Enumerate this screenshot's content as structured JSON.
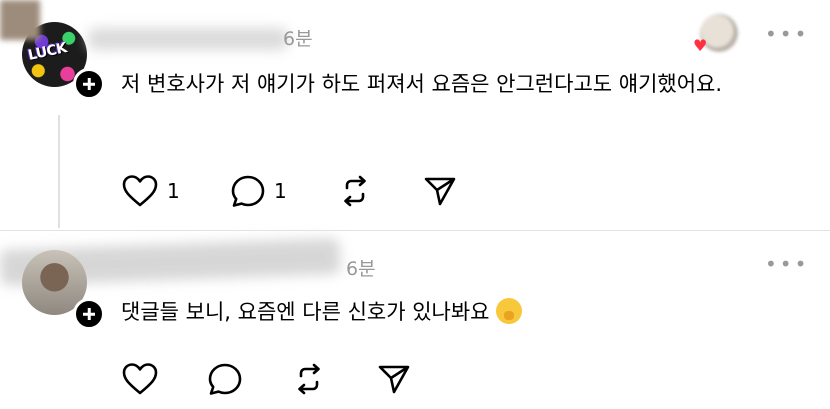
{
  "comments": [
    {
      "time": "6분",
      "text": "저 변호사가 저 얘기가 하도 퍼져서 요즘은 안그런다고도 얘기했어요.",
      "like_count": "1",
      "reply_count": "1",
      "avatar_text": "LUCK"
    },
    {
      "time": "6분",
      "text": "댓글들 보니, 요즘엔 다른 신호가 있나봐요",
      "like_count": "",
      "reply_count": ""
    }
  ],
  "more_label": "•••",
  "colors": {
    "heart_accent": "#ff3040",
    "muted": "#999999"
  }
}
